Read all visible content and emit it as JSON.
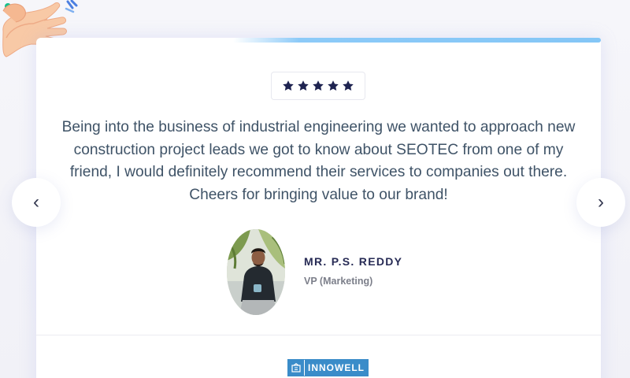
{
  "testimonial": {
    "rating_stars": 5,
    "quote": "Being into the business of industrial engineering we wanted to approach new construction project leads we got to know about SEOTEC from one of my friend, I would definitely recommend their services to companies out there. Cheers for bringing value to our brand!",
    "name": "MR. P.S. REDDY",
    "role": "VP (Marketing)"
  },
  "brand": {
    "name": "INNOWELL",
    "color": "#3a8cc9"
  },
  "navigation": {
    "prev_glyph": "‹",
    "next_glyph": "›"
  },
  "icons": {
    "decoration": "clapping-hands-icon",
    "star": "star-icon",
    "prev": "chevron-left-icon",
    "next": "chevron-right-icon",
    "brand_mark": "logo-mark-icon"
  },
  "colors": {
    "star": "#1e2350",
    "quote_text": "#3f5367",
    "name_text": "#272b55",
    "role_text": "#7c7f8a",
    "accent_line": "#84c6f6"
  }
}
